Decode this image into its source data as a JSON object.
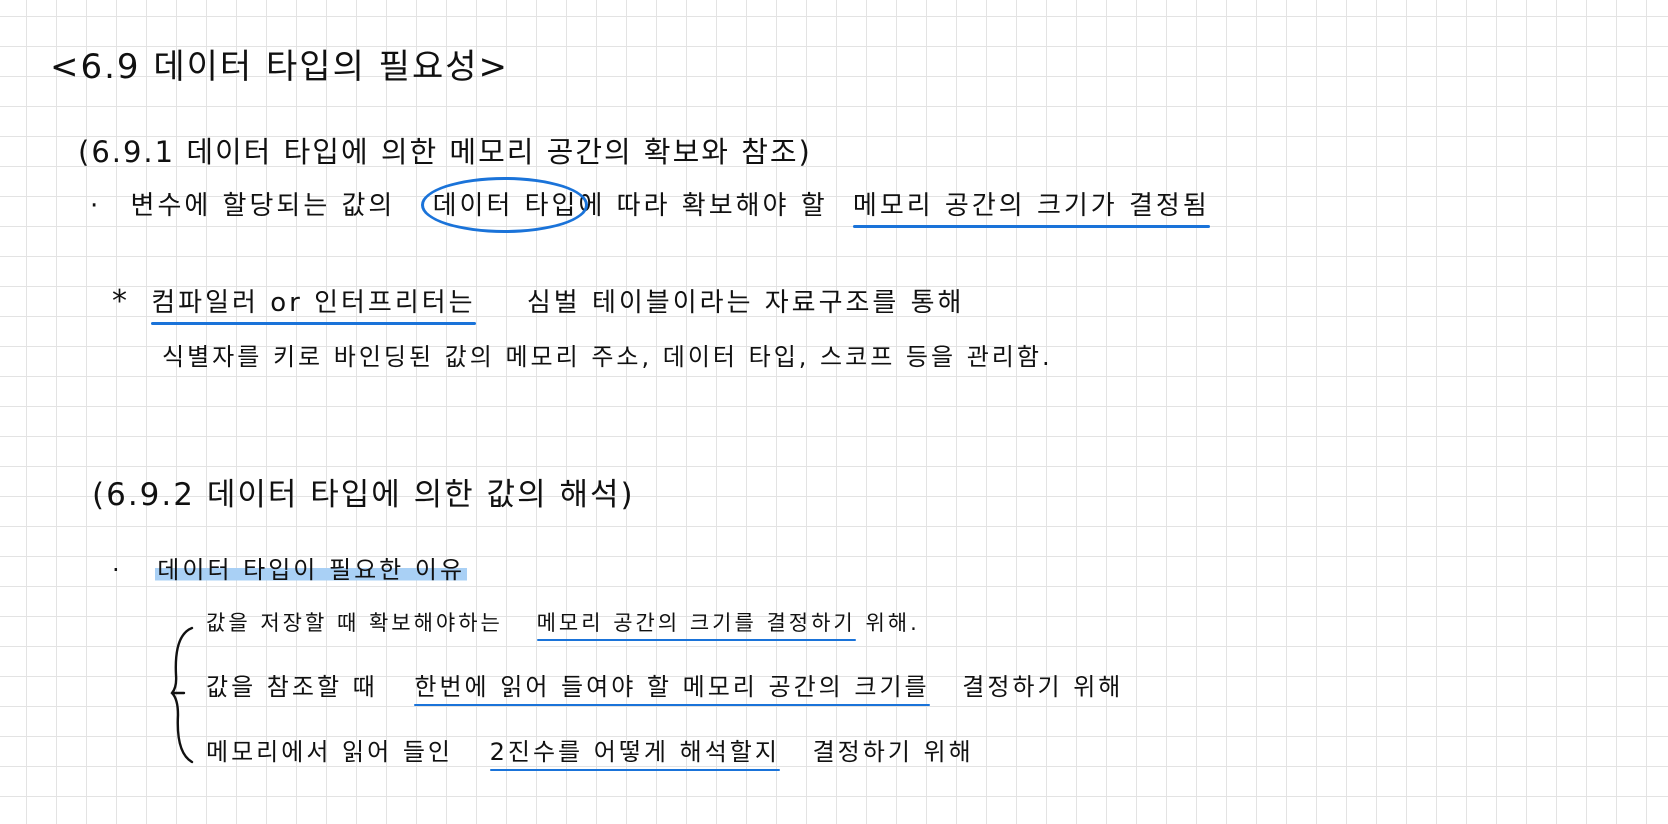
{
  "note": {
    "title": "<6.9 데이터 타입의 필요성>",
    "section1": {
      "heading": "(6.9.1 데이터 타입에 의한 메모리 공간의 확보와 참조)",
      "bullet": {
        "marker": "·",
        "part1": "변수에 할당되는 값의",
        "circled": "데이터 타입",
        "part2": "에 따라 확보해야 할",
        "underlined": "메모리 공간의 크기가 결정됨"
      },
      "note": {
        "marker": "*",
        "underlined": "컴파일러 or 인터프리터는",
        "rest": "심벌 테이블이라는 자료구조를 통해",
        "line2": "식별자를 키로 바인딩된 값의 메모리 주소, 데이터 타입, 스코프 등을 관리함."
      }
    },
    "section2": {
      "heading": "(6.9.2 데이터 타입에 의한 값의 해석)",
      "bullet": {
        "marker": "·",
        "highlighted": "데이터 타입이 필요한 이유"
      },
      "reasons": [
        {
          "pre": "값을 저장할 때 확보해야하는",
          "underlined": "메모리 공간의 크기를 결정하기",
          "post": "위해."
        },
        {
          "pre": "값을 참조할 때",
          "underlined": "한번에 읽어 들여야 할 메모리 공간의 크기를",
          "post": "결정하기 위해"
        },
        {
          "pre": "메모리에서 읽어 들인",
          "underlined": "2진수를 어떻게 해석할지",
          "post": "결정하기 위해"
        }
      ]
    },
    "colors": {
      "accent_ink": "#1a73d9",
      "highlight": "#a9d0f5",
      "grid": "#e3e3e3",
      "ink": "#111111"
    }
  }
}
